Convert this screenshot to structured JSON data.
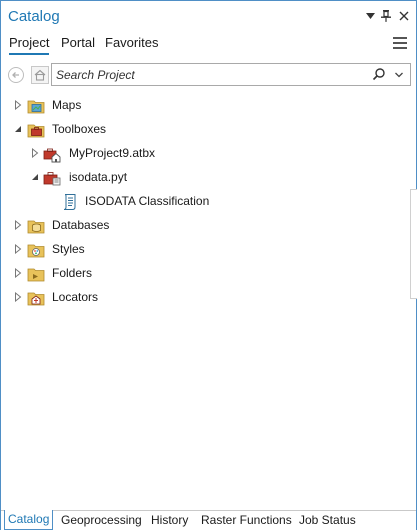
{
  "window": {
    "title": "Catalog"
  },
  "tabs": [
    {
      "label": "Project",
      "active": true
    },
    {
      "label": "Portal",
      "active": false
    },
    {
      "label": "Favorites",
      "active": false
    }
  ],
  "search": {
    "placeholder": "Search Project",
    "value": ""
  },
  "tree": [
    {
      "label": "Maps",
      "icon": "maps-folder-icon",
      "expanded": false,
      "level": 0
    },
    {
      "label": "Toolboxes",
      "icon": "toolboxes-folder-icon",
      "expanded": true,
      "level": 0
    },
    {
      "label": "MyProject9.atbx",
      "icon": "toolbox-home-icon",
      "expanded": false,
      "level": 1
    },
    {
      "label": "isodata.pyt",
      "icon": "python-toolbox-icon",
      "expanded": true,
      "level": 1
    },
    {
      "label": "ISODATA Classification",
      "icon": "script-tool-icon",
      "expanded": null,
      "level": 2
    },
    {
      "label": "Databases",
      "icon": "databases-folder-icon",
      "expanded": false,
      "level": 0
    },
    {
      "label": "Styles",
      "icon": "styles-folder-icon",
      "expanded": false,
      "level": 0
    },
    {
      "label": "Folders",
      "icon": "folders-folder-icon",
      "expanded": false,
      "level": 0
    },
    {
      "label": "Locators",
      "icon": "locators-folder-icon",
      "expanded": false,
      "level": 0
    }
  ],
  "bottom_tabs": [
    {
      "label": "Catalog",
      "active": true
    },
    {
      "label": "Geoprocessing",
      "active": false
    },
    {
      "label": "History",
      "active": false
    },
    {
      "label": "Raster Functions",
      "active": false
    },
    {
      "label": "Job Status",
      "active": false
    }
  ],
  "colors": {
    "accent": "#1f78b4",
    "folder": "#e8c25a",
    "toolbox": "#c0392b"
  }
}
